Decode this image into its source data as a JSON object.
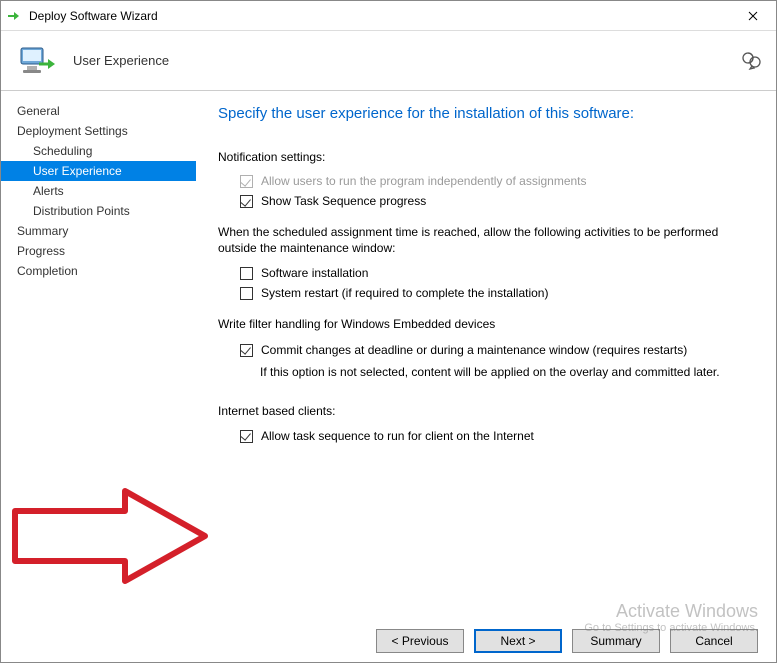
{
  "window": {
    "title": "Deploy Software Wizard"
  },
  "header": {
    "pageTitle": "User Experience"
  },
  "sidebar": {
    "items": [
      {
        "label": "General",
        "child": false,
        "selected": false
      },
      {
        "label": "Deployment Settings",
        "child": false,
        "selected": false
      },
      {
        "label": "Scheduling",
        "child": true,
        "selected": false
      },
      {
        "label": "User Experience",
        "child": true,
        "selected": true
      },
      {
        "label": "Alerts",
        "child": true,
        "selected": false
      },
      {
        "label": "Distribution Points",
        "child": true,
        "selected": false
      },
      {
        "label": "Summary",
        "child": false,
        "selected": false
      },
      {
        "label": "Progress",
        "child": false,
        "selected": false
      },
      {
        "label": "Completion",
        "child": false,
        "selected": false
      }
    ]
  },
  "content": {
    "heading": "Specify the user experience for the installation of this software:",
    "notificationLabel": "Notification settings:",
    "chkAllowUsers": {
      "label": "Allow users to run the program independently of assignments",
      "checked": true,
      "disabled": true
    },
    "chkShowProgress": {
      "label": "Show Task Sequence progress",
      "checked": true,
      "disabled": false
    },
    "maintenancePara": "When the scheduled assignment time is reached, allow the following activities to be performed outside the maintenance window:",
    "chkSoftwareInstall": {
      "label": "Software installation",
      "checked": false,
      "disabled": false
    },
    "chkSystemRestart": {
      "label": "System restart (if required to complete the installation)",
      "checked": false,
      "disabled": false
    },
    "writeFilterLabel": "Write filter handling for Windows Embedded devices",
    "chkCommit": {
      "label": "Commit changes at deadline or during a maintenance window (requires restarts)",
      "checked": true,
      "disabled": false
    },
    "commitNote": "If this option is not selected, content will be applied on the overlay and committed later.",
    "internetLabel": "Internet based clients:",
    "chkInternet": {
      "label": "Allow task sequence to run for client on the Internet",
      "checked": true,
      "disabled": false
    }
  },
  "footer": {
    "previous": "< Previous",
    "next": "Next >",
    "summary": "Summary",
    "cancel": "Cancel"
  },
  "watermark": {
    "line1": "Activate Windows",
    "line2": "Go to Settings to activate Windows."
  }
}
